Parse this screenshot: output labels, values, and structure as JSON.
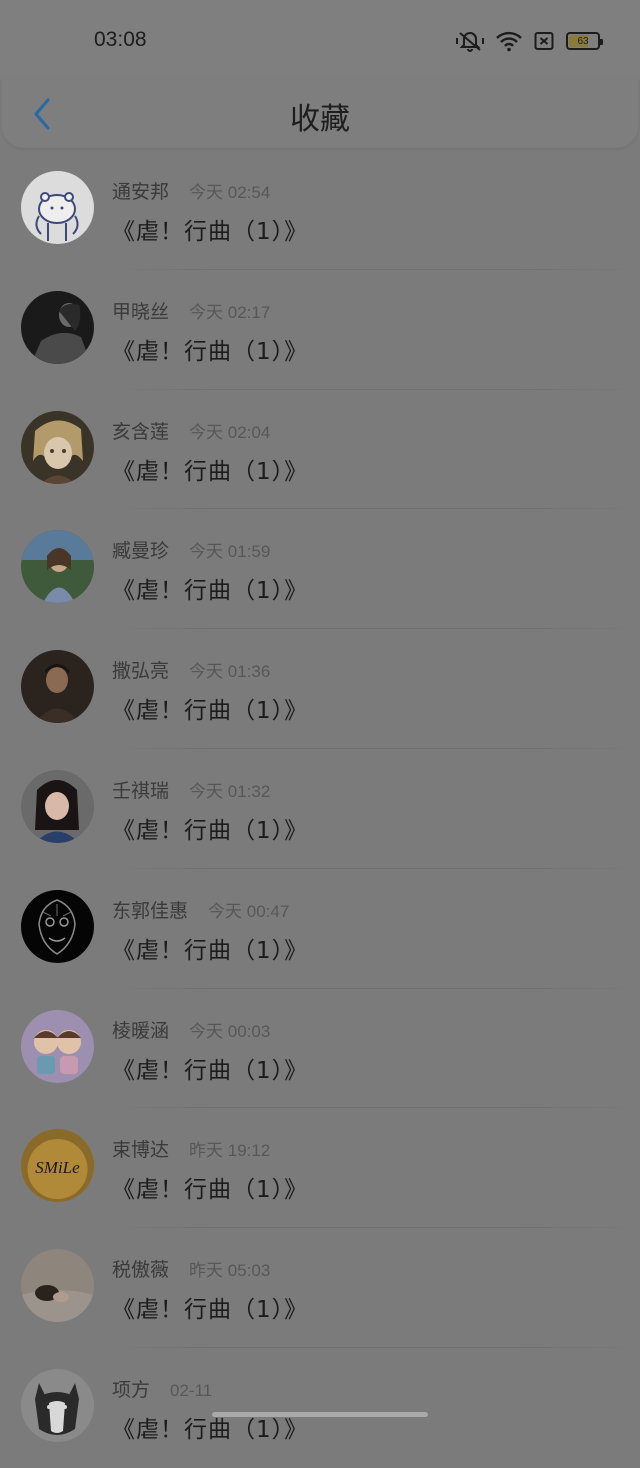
{
  "status_bar": {
    "time": "03:08",
    "battery": "63",
    "battery_fraction": 0.63
  },
  "header": {
    "title": "收藏",
    "back_icon": "chevron-left-icon",
    "accent_color": "#2b6aa0"
  },
  "items": [
    {
      "name": "通安邦",
      "time": "今天 02:54",
      "title": "《虐！行曲（1）》",
      "avatar": "bear-cartoon"
    },
    {
      "name": "甲晓丝",
      "time": "今天 02:17",
      "title": "《虐！行曲（1）》",
      "avatar": "bw-portrait"
    },
    {
      "name": "亥含莲",
      "time": "今天 02:04",
      "title": "《虐！行曲（1）》",
      "avatar": "anime-character"
    },
    {
      "name": "臧曼珍",
      "time": "今天 01:59",
      "title": "《虐！行曲（1）》",
      "avatar": "child-photo"
    },
    {
      "name": "撒弘亮",
      "time": "今天 01:36",
      "title": "《虐！行曲（1）》",
      "avatar": "man-photo"
    },
    {
      "name": "壬祺瑞",
      "time": "今天 01:32",
      "title": "《虐！行曲（1）》",
      "avatar": "girl-photo"
    },
    {
      "name": "东郭佳惠",
      "time": "今天 00:47",
      "title": "《虐！行曲（1）》",
      "avatar": "dark-mask"
    },
    {
      "name": "棱暖涵",
      "time": "今天 00:03",
      "title": "《虐！行曲（1）》",
      "avatar": "couple-cartoon"
    },
    {
      "name": "束博达",
      "time": "昨天 19:12",
      "title": "《虐！行曲（1）》",
      "avatar": "smile-logo",
      "avatar_text": "SMiLe"
    },
    {
      "name": "税傲薇",
      "time": "昨天 05:03",
      "title": "《虐！行曲（1）》",
      "avatar": "sleeping-photo"
    },
    {
      "name": "项方",
      "time": "02-11",
      "title": "《虐！行曲（1）》",
      "avatar": "husky-dog"
    }
  ]
}
